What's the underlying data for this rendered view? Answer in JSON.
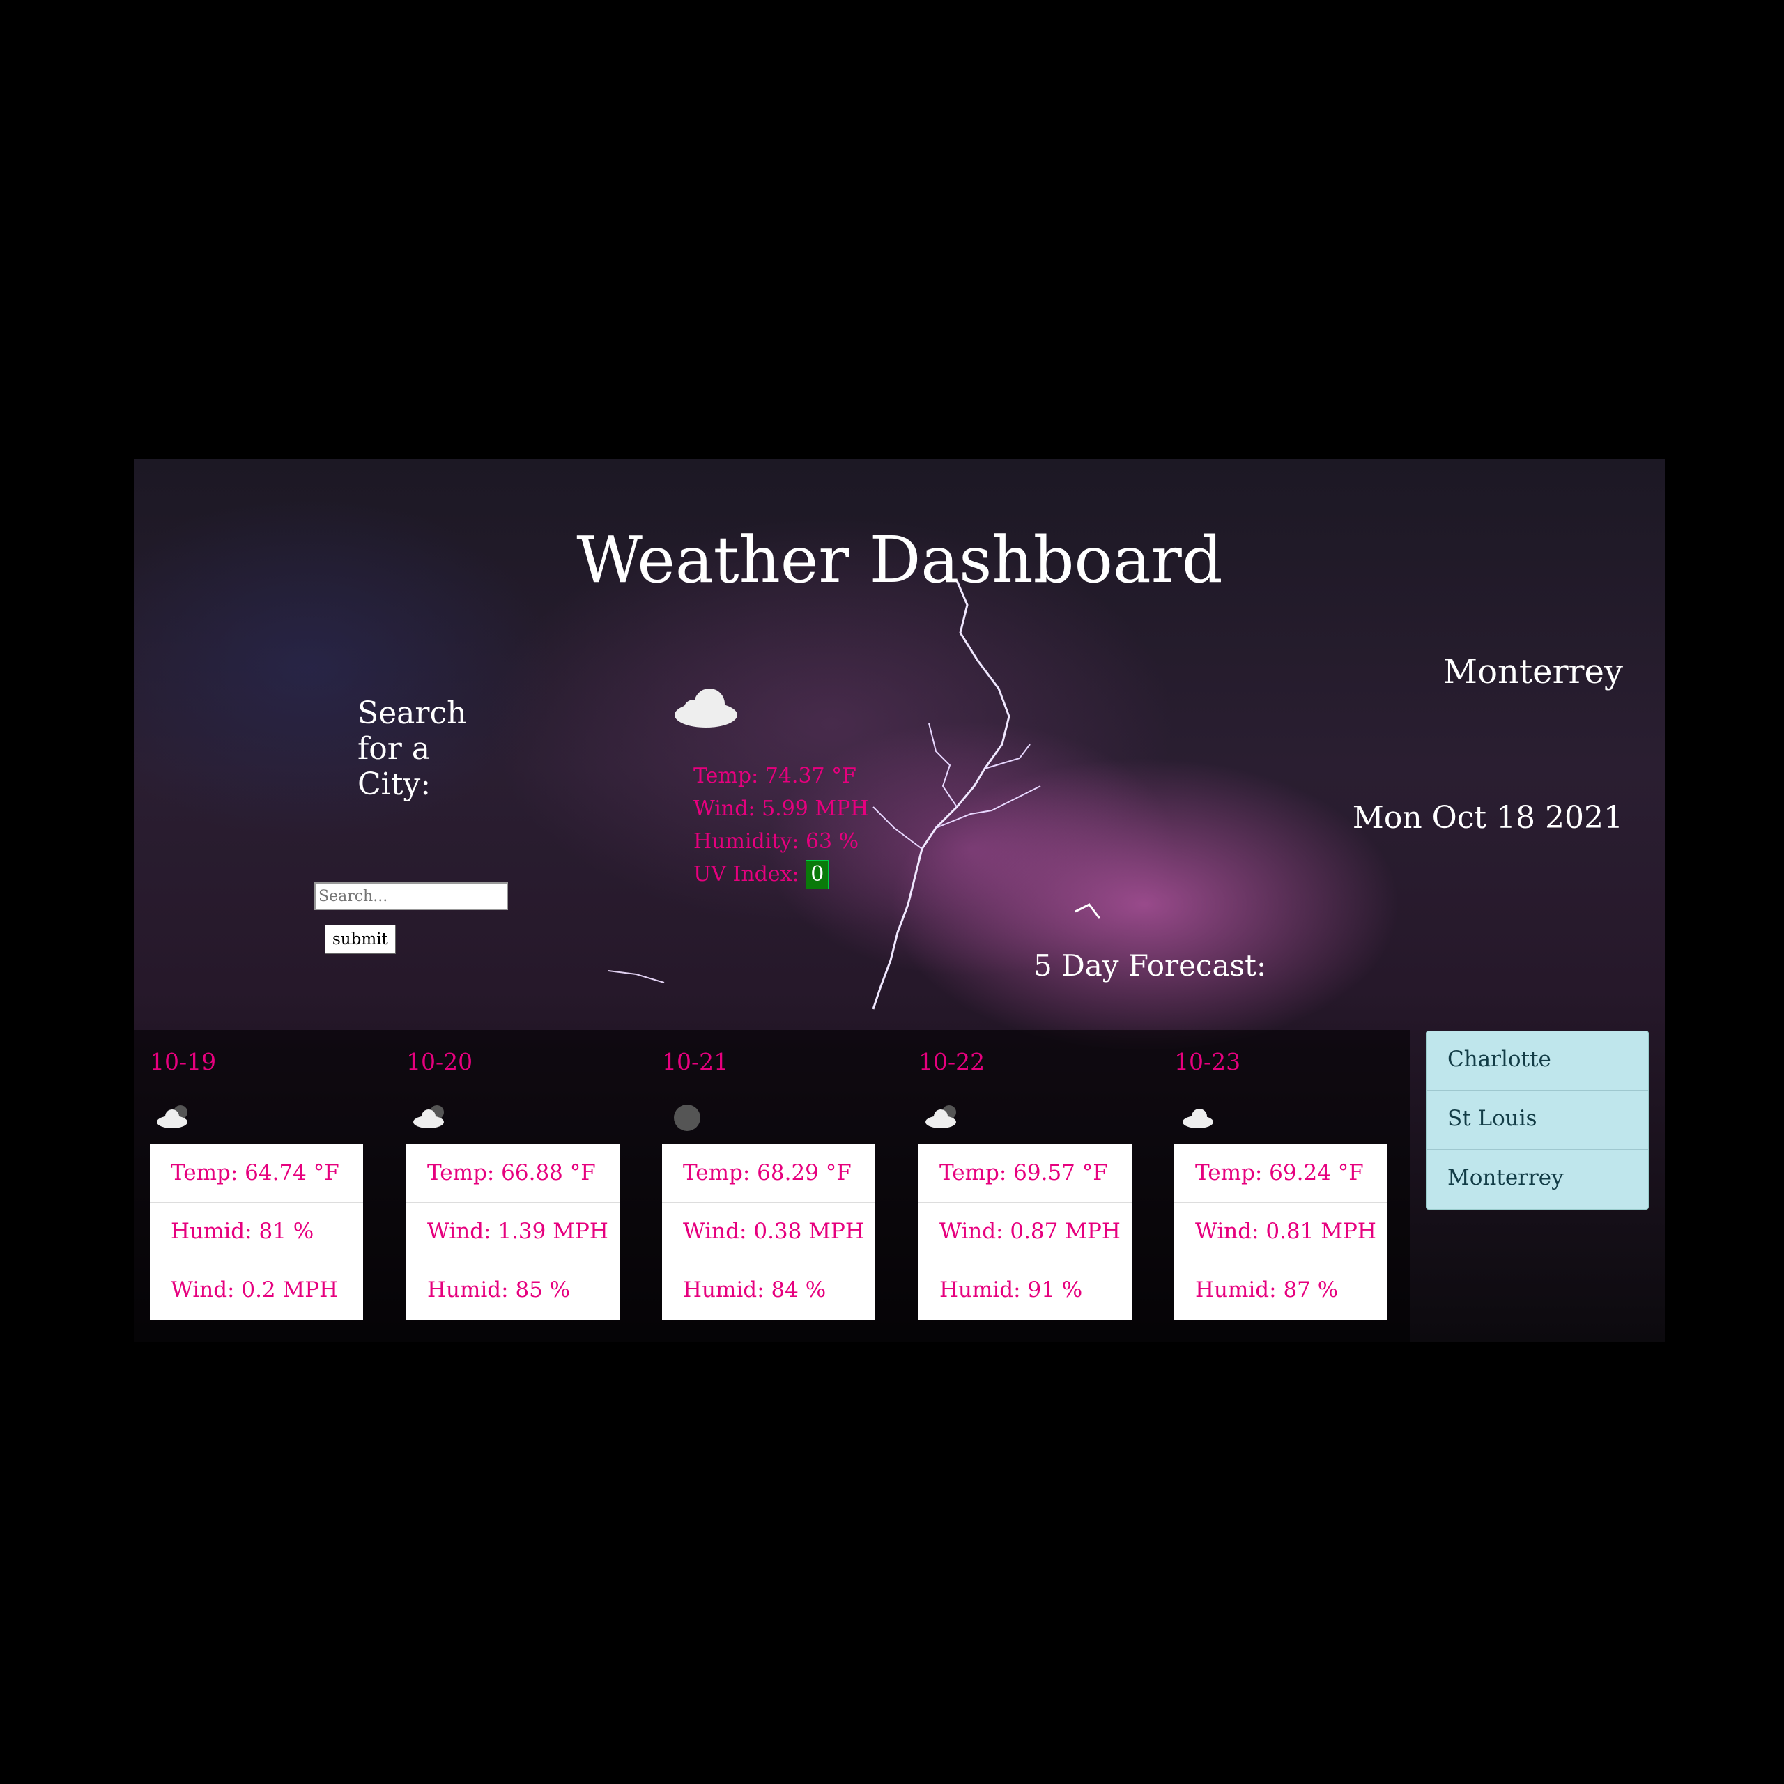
{
  "header": {
    "title": "Weather Dashboard"
  },
  "search": {
    "label": "Search for a City:",
    "placeholder": "Search...",
    "submit_label": "submit"
  },
  "current": {
    "icon": "cloud-icon",
    "city": "Monterrey",
    "date": "Mon Oct 18 2021",
    "temp": "Temp: 74.37 °F",
    "wind": "Wind: 5.99 MPH",
    "humidity": "Humidity: 63 %",
    "uv_label": "UV Index:",
    "uv_value": "0"
  },
  "forecast": {
    "heading": "5 Day Forecast:",
    "days": [
      {
        "date": "10-19",
        "icon": "cloudy-icon",
        "lines": [
          "Temp: 64.74 °F",
          "Humid: 81 %",
          "Wind: 0.2 MPH"
        ]
      },
      {
        "date": "10-20",
        "icon": "cloudy-icon",
        "lines": [
          "Temp: 66.88 °F",
          "Wind: 1.39 MPH",
          "Humid: 85 %"
        ]
      },
      {
        "date": "10-21",
        "icon": "overcast-icon",
        "lines": [
          "Temp: 68.29 °F",
          "Wind: 0.38 MPH",
          "Humid: 84 %"
        ]
      },
      {
        "date": "10-22",
        "icon": "cloudy-icon",
        "lines": [
          "Temp: 69.57 °F",
          "Wind: 0.87 MPH",
          "Humid: 91 %"
        ]
      },
      {
        "date": "10-23",
        "icon": "cloud-icon",
        "lines": [
          "Temp: 69.24 °F",
          "Wind: 0.81 MPH",
          "Humid: 87 %"
        ]
      }
    ]
  },
  "history": [
    "Charlotte",
    "St Louis",
    "Monterrey"
  ],
  "colors": {
    "accent": "#e6007e",
    "uv_badge": "#0a7a0a",
    "history_bg": "#bfe6ec"
  }
}
